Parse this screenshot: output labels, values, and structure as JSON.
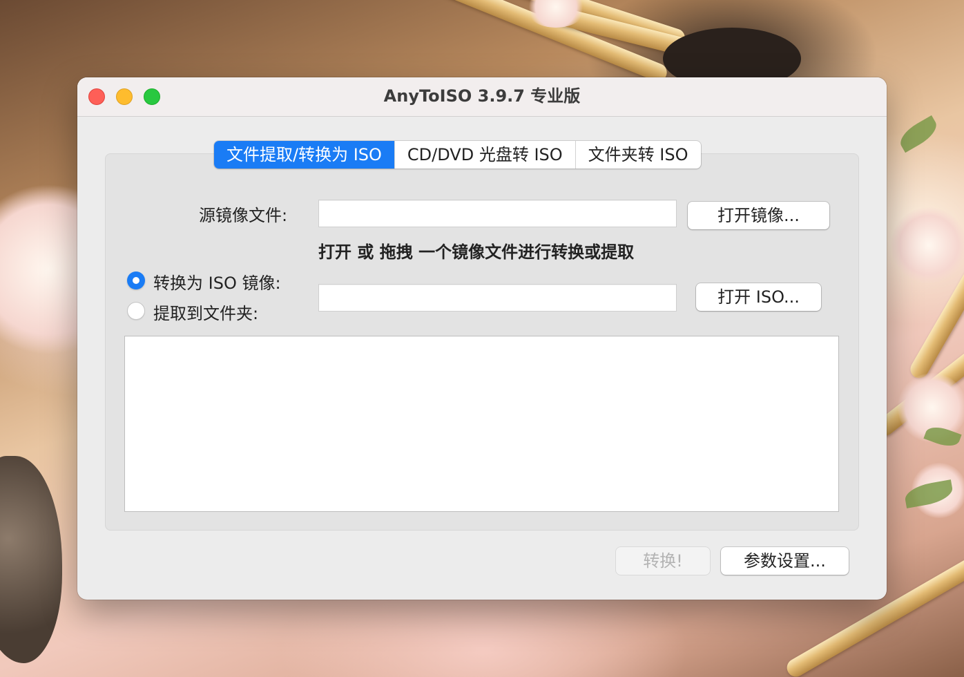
{
  "window": {
    "title": "AnyToISO 3.9.7 专业版"
  },
  "tabs": [
    {
      "label": "文件提取/转换为 ISO",
      "active": true
    },
    {
      "label": "CD/DVD 光盘转 ISO",
      "active": false
    },
    {
      "label": "文件夹转 ISO",
      "active": false
    }
  ],
  "source": {
    "label": "源镜像文件:",
    "value": "",
    "open_button": "打开镜像..."
  },
  "hint": "打开 或 拖拽 一个镜像文件进行转换或提取",
  "mode": {
    "convert_label": "转换为 ISO 镜像:",
    "extract_label": "提取到文件夹:",
    "selected": "convert",
    "output_value": "",
    "open_iso_button": "打开 ISO..."
  },
  "log": {
    "text": ""
  },
  "footer": {
    "convert_button": "转换!",
    "settings_button": "参数设置..."
  },
  "colors": {
    "accent": "#1a7cf5",
    "traffic_close": "#fe5f57",
    "traffic_minimize": "#febc2e",
    "traffic_maximize": "#28c840"
  }
}
